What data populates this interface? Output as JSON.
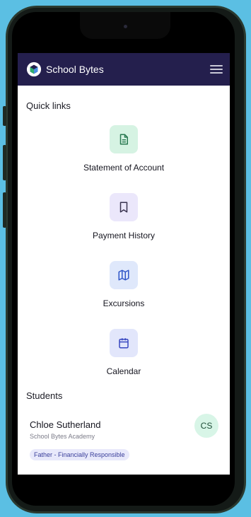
{
  "app": {
    "brand": "School Bytes",
    "colors": {
      "header": "#241f4d",
      "background": "#5bbfe3"
    }
  },
  "quick_links": {
    "title": "Quick links",
    "items": [
      {
        "label": "Statement of Account",
        "icon": "document-icon",
        "bg": "#d6f3e3",
        "color": "#2a7a52"
      },
      {
        "label": "Payment History",
        "icon": "bookmark-icon",
        "bg": "#ebe7fb",
        "color": "#3a3450"
      },
      {
        "label": "Excursions",
        "icon": "map-icon",
        "bg": "#dfe8fb",
        "color": "#2f56c8"
      },
      {
        "label": "Calendar",
        "icon": "calendar-icon",
        "bg": "#e2e6fb",
        "color": "#3747c0"
      }
    ]
  },
  "students": {
    "title": "Students",
    "items": [
      {
        "name": "Chloe Sutherland",
        "school": "School Bytes Academy",
        "initials": "CS",
        "role": "Father - Financially Responsible"
      }
    ]
  }
}
